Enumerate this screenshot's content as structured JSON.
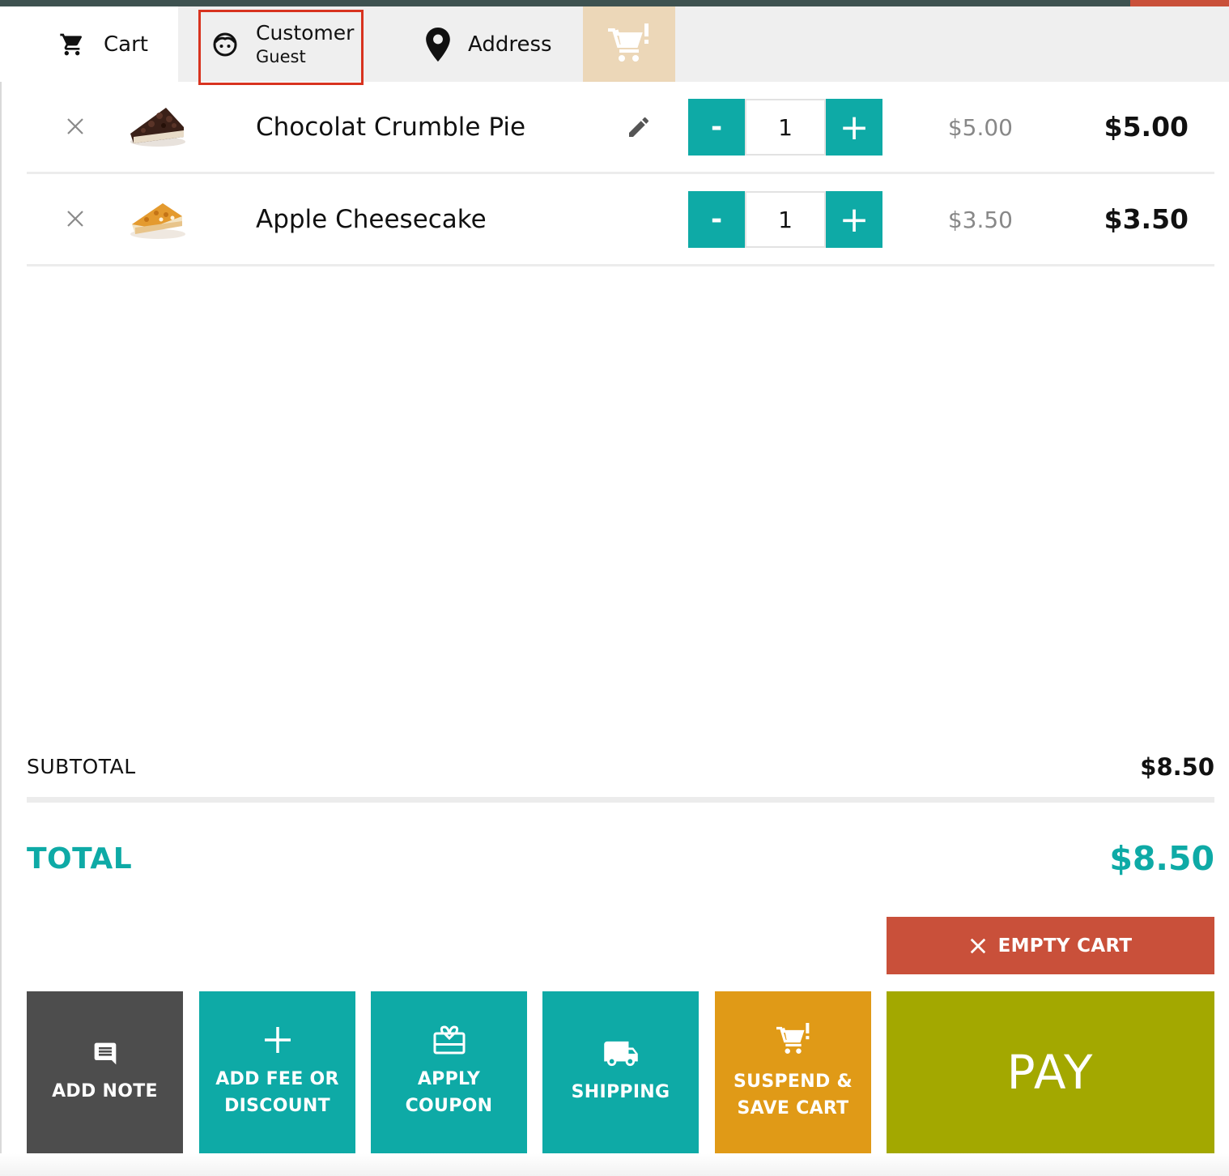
{
  "tabs": {
    "cart": {
      "label": "Cart",
      "icon": "cart-icon"
    },
    "customer": {
      "label": "Customer",
      "sublabel": "Guest",
      "icon": "face-icon"
    },
    "address": {
      "label": "Address",
      "icon": "location-pin-icon"
    },
    "suspended": {
      "icon": "cart-alert-icon"
    }
  },
  "items": [
    {
      "name": "Chocolat Crumble Pie",
      "quantity": "1",
      "unit_price": "$5.00",
      "line_total": "$5.00",
      "editable": true,
      "thumbnail": "chocolate-pie-slice"
    },
    {
      "name": "Apple Cheesecake",
      "quantity": "1",
      "unit_price": "$3.50",
      "line_total": "$3.50",
      "editable": false,
      "thumbnail": "apple-cheesecake-slice"
    }
  ],
  "qty_controls": {
    "minus": "-",
    "plus": "+"
  },
  "summary": {
    "subtotal_label": "SUBTOTAL",
    "subtotal_value": "$8.50",
    "total_label": "TOTAL",
    "total_value": "$8.50"
  },
  "buttons": {
    "empty_cart": "EMPTY CART",
    "add_note": "ADD NOTE",
    "add_fee": [
      "ADD FEE OR",
      "DISCOUNT"
    ],
    "apply_coupon": [
      "APPLY",
      "COUPON"
    ],
    "shipping": "SHIPPING",
    "suspend": [
      "SUSPEND &",
      "SAVE CART"
    ],
    "pay": "PAY"
  },
  "colors": {
    "teal": "#0eaaa6",
    "red": "#c9503a",
    "dark": "#4d4d4d",
    "orange": "#e09a17",
    "olive": "#a3a800",
    "highlight": "#d8331f"
  }
}
